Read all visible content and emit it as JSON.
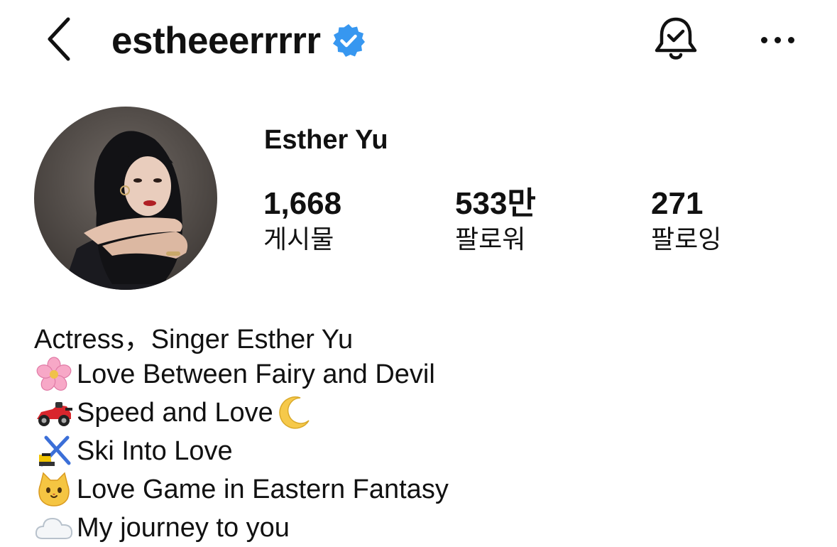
{
  "header": {
    "username": "estheeerrrrr",
    "verified": true,
    "icons": {
      "back": "chevron-left-icon",
      "verified": "verified-badge-icon",
      "notifications": "bell-check-icon",
      "more": "more-horizontal-icon"
    }
  },
  "profile": {
    "display_name": "Esther Yu",
    "avatar": "profile-photo",
    "stats": {
      "posts_value": "1,668",
      "posts_label": "게시물",
      "followers_value": "533만",
      "followers_label": "팔로워",
      "following_value": "271",
      "following_label": "팔로잉"
    }
  },
  "bio": {
    "lines": [
      {
        "prefix_emoji": "",
        "text": "Actress，Singer Esther Yu",
        "suffix_emoji": ""
      },
      {
        "prefix_emoji": "cherry-blossom",
        "text": "Love Between Fairy and Devil",
        "suffix_emoji": ""
      },
      {
        "prefix_emoji": "racing-car",
        "text": "Speed and Love",
        "suffix_emoji": "crescent-moon"
      },
      {
        "prefix_emoji": "skis",
        "text": "Ski Into Love",
        "suffix_emoji": ""
      },
      {
        "prefix_emoji": "cat-face",
        "text": "Love Game in Eastern Fantasy",
        "suffix_emoji": ""
      },
      {
        "prefix_emoji": "cloud",
        "text": "My journey to you",
        "suffix_emoji": ""
      }
    ]
  },
  "colors": {
    "text": "#111111",
    "background": "#ffffff",
    "verified_blue": "#3797f0"
  }
}
